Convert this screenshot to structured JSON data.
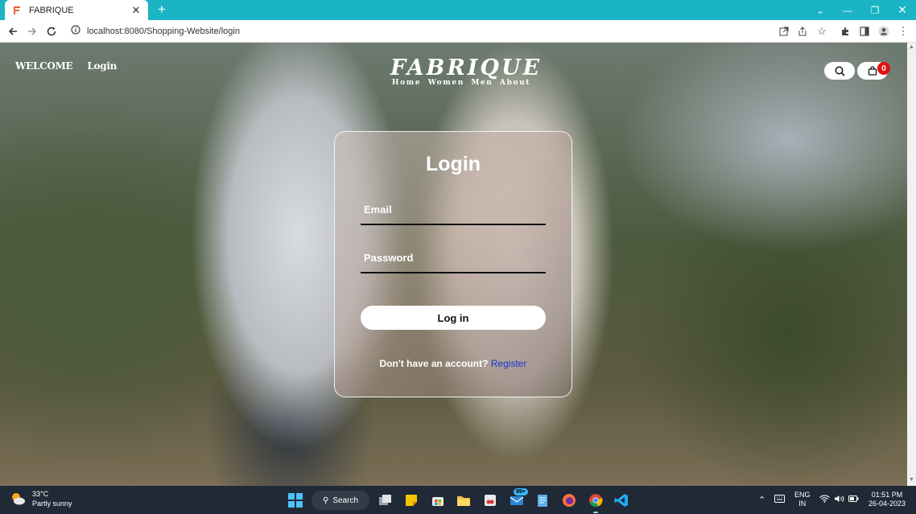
{
  "browser": {
    "tab_title": "FABRIQUE",
    "url": "localhost:8080/Shopping-Website/login",
    "new_tab_symbol": "+",
    "close_symbol": "✕"
  },
  "site": {
    "nav_left": [
      "WELCOME",
      "Login"
    ],
    "logo": "FABRIQUE",
    "logo_links": [
      "Home",
      "Women",
      "Men",
      "About"
    ],
    "cart_count": "0"
  },
  "login": {
    "title": "Login",
    "email_placeholder": "Email",
    "password_placeholder": "Password",
    "submit_label": "Log in",
    "register_prompt": "Don't have an account?",
    "register_link": "Register"
  },
  "taskbar": {
    "weather_temp": "33°C",
    "weather_desc": "Partly sunny",
    "search_label": "Search",
    "mail_badge": "99+",
    "lang_1": "ENG",
    "lang_2": "IN",
    "time": "01:51 PM",
    "date": "26-04-2023"
  },
  "colors": {
    "tabstrip": "#1bb4c4",
    "register_link": "#1f35d6",
    "cart_badge": "#e0110f",
    "taskbar": "#202a36"
  }
}
